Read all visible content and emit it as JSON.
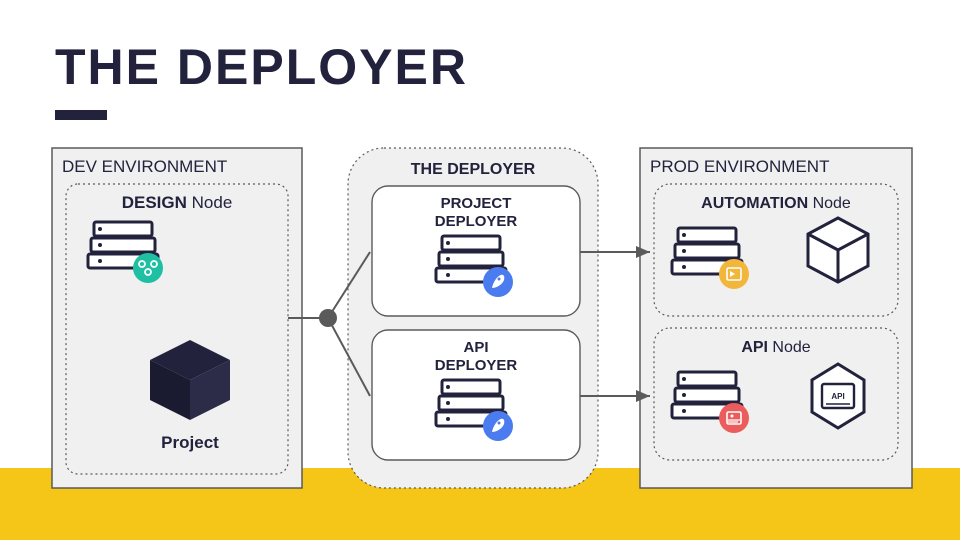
{
  "title": "THE DEPLOYER",
  "dev_env": {
    "label": "DEV ENVIRONMENT",
    "node_strong": "DESIGN",
    "node_rest": " Node",
    "project_label": "Project"
  },
  "deployer": {
    "label": "THE DEPLOYER",
    "project_top": "PROJECT",
    "project_bot": "DEPLOYER",
    "api_top": "API",
    "api_bot": "DEPLOYER"
  },
  "prod_env": {
    "label": "PROD ENVIRONMENT",
    "automation_strong": "AUTOMATION",
    "automation_rest": " Node",
    "api_strong": "API",
    "api_rest": " Node",
    "api_tag": "API"
  },
  "colors": {
    "dark": "#22223d",
    "light_fill": "#f0f0f0",
    "border": "#5a5a5a",
    "teal": "#1fbfa3",
    "blue": "#4a7cf0",
    "amber": "#f2b63a",
    "red": "#eb5d5d"
  }
}
